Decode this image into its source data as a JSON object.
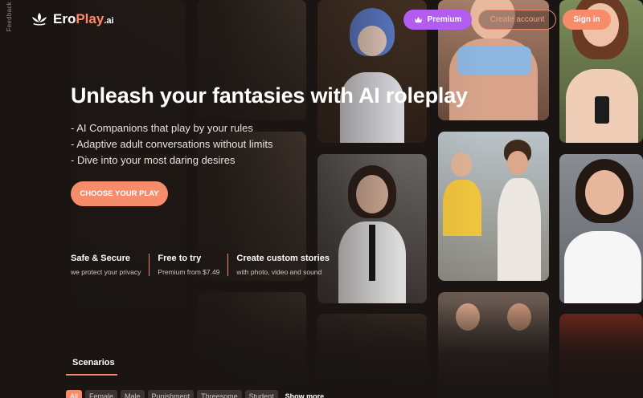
{
  "feedback": {
    "label": "Feedback"
  },
  "brand": {
    "name_main": "Ero",
    "name_accent": "Play",
    "name_suffix": ".ai"
  },
  "header": {
    "premium_label": "Premium",
    "create_account_label": "Create account",
    "signin_label": "Sign in"
  },
  "hero": {
    "title": "Unleash your fantasies with AI roleplay",
    "bullets": [
      "- AI Companions that play by your rules",
      "- Adaptive adult conversations without limits",
      "- Dive into your most daring desires"
    ],
    "cta_label": "CHOOSE YOUR PLAY"
  },
  "features": [
    {
      "title": "Safe & Secure",
      "subtitle": "we protect your privacy"
    },
    {
      "title": "Free to try",
      "subtitle": "Premium from $7.49"
    },
    {
      "title": "Create custom stories",
      "subtitle": "with photo, video and sound"
    }
  ],
  "scenarios": {
    "tab_label": "Scenarios",
    "chips": [
      "All",
      "Female",
      "Male",
      "Punishment",
      "Threesome",
      "Student"
    ],
    "show_more_label": "Show more"
  },
  "colors": {
    "background": "#1a1513",
    "accent": "#f78c6b",
    "premium": "#b25cf0"
  }
}
